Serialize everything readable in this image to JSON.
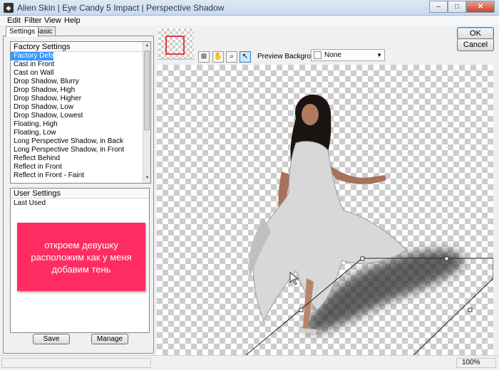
{
  "window": {
    "title": "Alien Skin | Eye Candy 5 Impact | Perspective Shadow",
    "icon": "alien-skin-app-icon",
    "controls": {
      "minimize": "–",
      "maximize": "□",
      "close": "✕"
    }
  },
  "menu": [
    "Edit",
    "Filter",
    "View",
    "Help"
  ],
  "tabs": [
    {
      "label": "Settings",
      "active": true
    },
    {
      "label": "Basic",
      "active": false
    }
  ],
  "factory_settings": {
    "header": "Factory Settings",
    "selected": "Factory Default",
    "items": [
      "Factory Default",
      "Cast in Front",
      "Cast on Wall",
      "Drop Shadow, Blurry",
      "Drop Shadow, High",
      "Drop Shadow, Higher",
      "Drop Shadow, Low",
      "Drop Shadow, Lowest",
      "Floating, High",
      "Floating, Low",
      "Long Perspective Shadow, in Back",
      "Long Perspective Shadow, in Front",
      "Reflect Behind",
      "Reflect in Front",
      "Reflect in Front - Faint"
    ]
  },
  "user_settings": {
    "header": "User Settings",
    "items": [
      "Last Used"
    ]
  },
  "annotation": {
    "lines": [
      "откроем девушку",
      "расположим как у меня",
      "добавим тень"
    ],
    "color": "#fe2c63"
  },
  "buttons": {
    "save": "Save",
    "manage": "Manage",
    "ok": "OK",
    "cancel": "Cancel"
  },
  "tools": [
    "navigator-icon",
    "hand-icon",
    "zoom-icon",
    "pointer-icon"
  ],
  "preview_background": {
    "label": "Preview Background:",
    "value": "None"
  },
  "status": {
    "zoom": "100%"
  }
}
